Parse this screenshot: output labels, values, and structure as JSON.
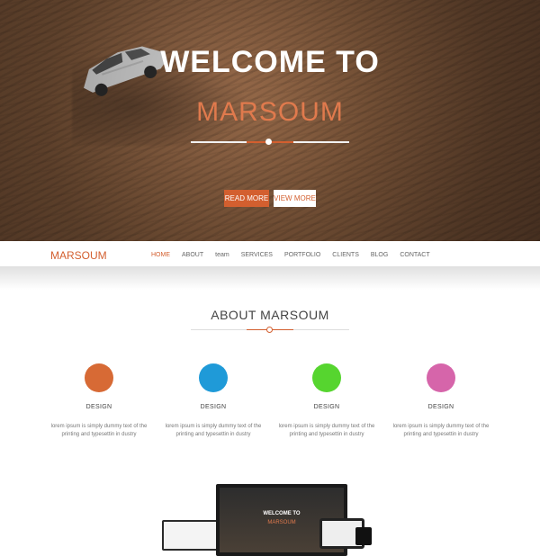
{
  "hero": {
    "title_line1": "WELCOME TO",
    "title_line2": "MARSOUM",
    "buttons": {
      "read_more": "READ MORE",
      "view_more": "VIEW MORE"
    },
    "colors": {
      "accent": "#d35f2f",
      "highlight": "#e07a4d"
    }
  },
  "nav": {
    "brand": "MARSOUM",
    "items": [
      "HOME",
      "ABOUT",
      "team",
      "SERVICES",
      "PORTFOLIO",
      "CLIENTS",
      "BLOG",
      "CONTACT"
    ],
    "active": "HOME"
  },
  "about": {
    "title": "ABOUT MARSOUM",
    "features": [
      {
        "label": "DESIGN",
        "color": "#d76a35",
        "text": "lorem ipsum is simply dummy text of the printing and typesettin in dustry"
      },
      {
        "label": "DESIGN",
        "color": "#1f9ad8",
        "text": "lorem ipsum is simply dummy text of the printing and typesettin in dustry"
      },
      {
        "label": "DESIGN",
        "color": "#56d52f",
        "text": "lorem ipsum is simply dummy text of the printing and typesettin in dustry"
      },
      {
        "label": "DESIGN",
        "color": "#d665aa",
        "text": "lorem ipsum is simply dummy text of the printing and typesettin in dustry"
      }
    ]
  },
  "devices": {
    "monitor_title_line1": "WELCOME TO",
    "monitor_title_line2": "MARSOUM"
  }
}
